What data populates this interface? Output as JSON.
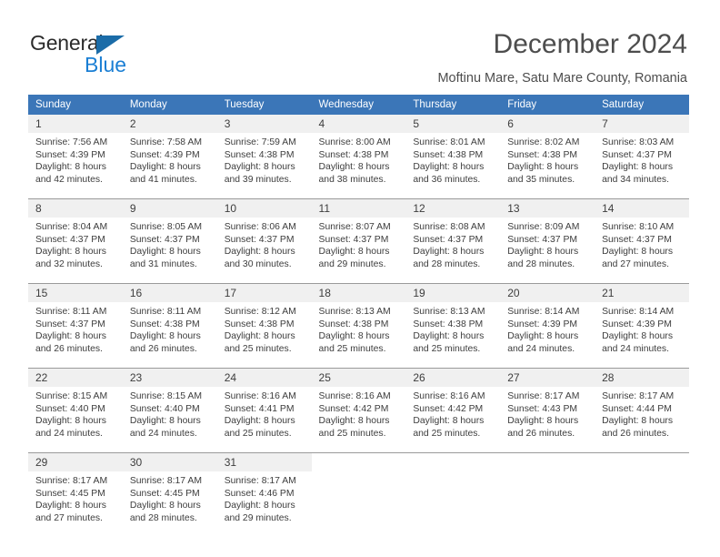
{
  "brand": {
    "name_top": "General",
    "name_bottom": "Blue",
    "accent_color": "#1b6ca8",
    "blue_text_color": "#1b7fd4"
  },
  "header": {
    "title": "December 2024",
    "subtitle": "Moftinu Mare, Satu Mare County, Romania",
    "header_bg_color": "#3b76b8",
    "daynum_bg_color": "#f0f0f0"
  },
  "weekday_headers": [
    "Sunday",
    "Monday",
    "Tuesday",
    "Wednesday",
    "Thursday",
    "Friday",
    "Saturday"
  ],
  "weeks": [
    [
      {
        "day": "1",
        "sunrise": "Sunrise: 7:56 AM",
        "sunset": "Sunset: 4:39 PM",
        "daylight1": "Daylight: 8 hours",
        "daylight2": "and 42 minutes."
      },
      {
        "day": "2",
        "sunrise": "Sunrise: 7:58 AM",
        "sunset": "Sunset: 4:39 PM",
        "daylight1": "Daylight: 8 hours",
        "daylight2": "and 41 minutes."
      },
      {
        "day": "3",
        "sunrise": "Sunrise: 7:59 AM",
        "sunset": "Sunset: 4:38 PM",
        "daylight1": "Daylight: 8 hours",
        "daylight2": "and 39 minutes."
      },
      {
        "day": "4",
        "sunrise": "Sunrise: 8:00 AM",
        "sunset": "Sunset: 4:38 PM",
        "daylight1": "Daylight: 8 hours",
        "daylight2": "and 38 minutes."
      },
      {
        "day": "5",
        "sunrise": "Sunrise: 8:01 AM",
        "sunset": "Sunset: 4:38 PM",
        "daylight1": "Daylight: 8 hours",
        "daylight2": "and 36 minutes."
      },
      {
        "day": "6",
        "sunrise": "Sunrise: 8:02 AM",
        "sunset": "Sunset: 4:38 PM",
        "daylight1": "Daylight: 8 hours",
        "daylight2": "and 35 minutes."
      },
      {
        "day": "7",
        "sunrise": "Sunrise: 8:03 AM",
        "sunset": "Sunset: 4:37 PM",
        "daylight1": "Daylight: 8 hours",
        "daylight2": "and 34 minutes."
      }
    ],
    [
      {
        "day": "8",
        "sunrise": "Sunrise: 8:04 AM",
        "sunset": "Sunset: 4:37 PM",
        "daylight1": "Daylight: 8 hours",
        "daylight2": "and 32 minutes."
      },
      {
        "day": "9",
        "sunrise": "Sunrise: 8:05 AM",
        "sunset": "Sunset: 4:37 PM",
        "daylight1": "Daylight: 8 hours",
        "daylight2": "and 31 minutes."
      },
      {
        "day": "10",
        "sunrise": "Sunrise: 8:06 AM",
        "sunset": "Sunset: 4:37 PM",
        "daylight1": "Daylight: 8 hours",
        "daylight2": "and 30 minutes."
      },
      {
        "day": "11",
        "sunrise": "Sunrise: 8:07 AM",
        "sunset": "Sunset: 4:37 PM",
        "daylight1": "Daylight: 8 hours",
        "daylight2": "and 29 minutes."
      },
      {
        "day": "12",
        "sunrise": "Sunrise: 8:08 AM",
        "sunset": "Sunset: 4:37 PM",
        "daylight1": "Daylight: 8 hours",
        "daylight2": "and 28 minutes."
      },
      {
        "day": "13",
        "sunrise": "Sunrise: 8:09 AM",
        "sunset": "Sunset: 4:37 PM",
        "daylight1": "Daylight: 8 hours",
        "daylight2": "and 28 minutes."
      },
      {
        "day": "14",
        "sunrise": "Sunrise: 8:10 AM",
        "sunset": "Sunset: 4:37 PM",
        "daylight1": "Daylight: 8 hours",
        "daylight2": "and 27 minutes."
      }
    ],
    [
      {
        "day": "15",
        "sunrise": "Sunrise: 8:11 AM",
        "sunset": "Sunset: 4:37 PM",
        "daylight1": "Daylight: 8 hours",
        "daylight2": "and 26 minutes."
      },
      {
        "day": "16",
        "sunrise": "Sunrise: 8:11 AM",
        "sunset": "Sunset: 4:38 PM",
        "daylight1": "Daylight: 8 hours",
        "daylight2": "and 26 minutes."
      },
      {
        "day": "17",
        "sunrise": "Sunrise: 8:12 AM",
        "sunset": "Sunset: 4:38 PM",
        "daylight1": "Daylight: 8 hours",
        "daylight2": "and 25 minutes."
      },
      {
        "day": "18",
        "sunrise": "Sunrise: 8:13 AM",
        "sunset": "Sunset: 4:38 PM",
        "daylight1": "Daylight: 8 hours",
        "daylight2": "and 25 minutes."
      },
      {
        "day": "19",
        "sunrise": "Sunrise: 8:13 AM",
        "sunset": "Sunset: 4:38 PM",
        "daylight1": "Daylight: 8 hours",
        "daylight2": "and 25 minutes."
      },
      {
        "day": "20",
        "sunrise": "Sunrise: 8:14 AM",
        "sunset": "Sunset: 4:39 PM",
        "daylight1": "Daylight: 8 hours",
        "daylight2": "and 24 minutes."
      },
      {
        "day": "21",
        "sunrise": "Sunrise: 8:14 AM",
        "sunset": "Sunset: 4:39 PM",
        "daylight1": "Daylight: 8 hours",
        "daylight2": "and 24 minutes."
      }
    ],
    [
      {
        "day": "22",
        "sunrise": "Sunrise: 8:15 AM",
        "sunset": "Sunset: 4:40 PM",
        "daylight1": "Daylight: 8 hours",
        "daylight2": "and 24 minutes."
      },
      {
        "day": "23",
        "sunrise": "Sunrise: 8:15 AM",
        "sunset": "Sunset: 4:40 PM",
        "daylight1": "Daylight: 8 hours",
        "daylight2": "and 24 minutes."
      },
      {
        "day": "24",
        "sunrise": "Sunrise: 8:16 AM",
        "sunset": "Sunset: 4:41 PM",
        "daylight1": "Daylight: 8 hours",
        "daylight2": "and 25 minutes."
      },
      {
        "day": "25",
        "sunrise": "Sunrise: 8:16 AM",
        "sunset": "Sunset: 4:42 PM",
        "daylight1": "Daylight: 8 hours",
        "daylight2": "and 25 minutes."
      },
      {
        "day": "26",
        "sunrise": "Sunrise: 8:16 AM",
        "sunset": "Sunset: 4:42 PM",
        "daylight1": "Daylight: 8 hours",
        "daylight2": "and 25 minutes."
      },
      {
        "day": "27",
        "sunrise": "Sunrise: 8:17 AM",
        "sunset": "Sunset: 4:43 PM",
        "daylight1": "Daylight: 8 hours",
        "daylight2": "and 26 minutes."
      },
      {
        "day": "28",
        "sunrise": "Sunrise: 8:17 AM",
        "sunset": "Sunset: 4:44 PM",
        "daylight1": "Daylight: 8 hours",
        "daylight2": "and 26 minutes."
      }
    ],
    [
      {
        "day": "29",
        "sunrise": "Sunrise: 8:17 AM",
        "sunset": "Sunset: 4:45 PM",
        "daylight1": "Daylight: 8 hours",
        "daylight2": "and 27 minutes."
      },
      {
        "day": "30",
        "sunrise": "Sunrise: 8:17 AM",
        "sunset": "Sunset: 4:45 PM",
        "daylight1": "Daylight: 8 hours",
        "daylight2": "and 28 minutes."
      },
      {
        "day": "31",
        "sunrise": "Sunrise: 8:17 AM",
        "sunset": "Sunset: 4:46 PM",
        "daylight1": "Daylight: 8 hours",
        "daylight2": "and 29 minutes."
      },
      {
        "day": "",
        "sunrise": "",
        "sunset": "",
        "daylight1": "",
        "daylight2": ""
      },
      {
        "day": "",
        "sunrise": "",
        "sunset": "",
        "daylight1": "",
        "daylight2": ""
      },
      {
        "day": "",
        "sunrise": "",
        "sunset": "",
        "daylight1": "",
        "daylight2": ""
      },
      {
        "day": "",
        "sunrise": "",
        "sunset": "",
        "daylight1": "",
        "daylight2": ""
      }
    ]
  ]
}
